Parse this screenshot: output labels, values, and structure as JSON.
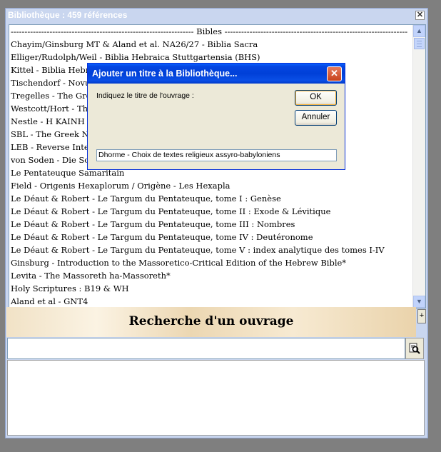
{
  "window": {
    "title": "Bibliothèque : 459 références",
    "close_glyph": "✕"
  },
  "list": {
    "header": "------------------------------------------------------------------ Bibles ------------------------------------------------------------------",
    "items": [
      "Chayim/Ginsburg MT & Aland et al. NA26/27 - Biblia Sacra",
      "Elliger/Rudolph/Weil - Biblia Hebraica Stuttgartensia (BHS)",
      "Kittel - Biblia Hebraica",
      "Tischendorf - Novum",
      "Tregelles - The Greek",
      "Westcott/Hort - The",
      "Nestle - H KAINH",
      "SBL - The Greek New",
      "LEB - Reverse Inter",
      "von Soden - Die Sch",
      "Le Pentateuque Samaritain",
      "Field - Origenis Hexaplorum / Origène - Les Hexapla",
      "Le Déaut & Robert - Le Targum du Pentateuque, tome I : Genèse",
      "Le Déaut & Robert - Le Targum du Pentateuque, tome II : Exode & Lévitique",
      "Le Déaut & Robert - Le Targum du Pentateuque, tome III : Nombres",
      "Le Déaut & Robert - Le Targum du Pentateuque, tome IV : Deutéronome",
      "Le Déaut & Robert - Le Targum du Pentateuque, tome V : index analytique des tomes I-IV",
      "Ginsburg - Introduction to the Massoretico-Critical Edition of the Hebrew Bible*",
      "Levita - The Massoreth ha-Massoreth*",
      "Holy Scriptures : B19 & WH",
      "Aland et al - GNT4"
    ]
  },
  "search": {
    "title": "Recherche d'un ouvrage",
    "value": "",
    "plus_label": "+"
  },
  "dialog": {
    "title": "Ajouter un titre à la Bibliothèque...",
    "prompt": "Indiquez le titre de l'ouvrage :",
    "ok_label": "OK",
    "cancel_label": "Annuler",
    "input_value": "Dhorme - Choix de textes religieux assyro-babyloniens"
  },
  "icons": {
    "window_close": "close-icon",
    "dialog_close": "close-icon",
    "scroll_up": "chevron-up-icon",
    "scroll_down": "chevron-down-icon",
    "search": "search-binoculars-icon"
  },
  "colors": {
    "dialog_title": "#0040d8",
    "window_title": "#c9d6ef",
    "band": "#f1e2c6"
  }
}
